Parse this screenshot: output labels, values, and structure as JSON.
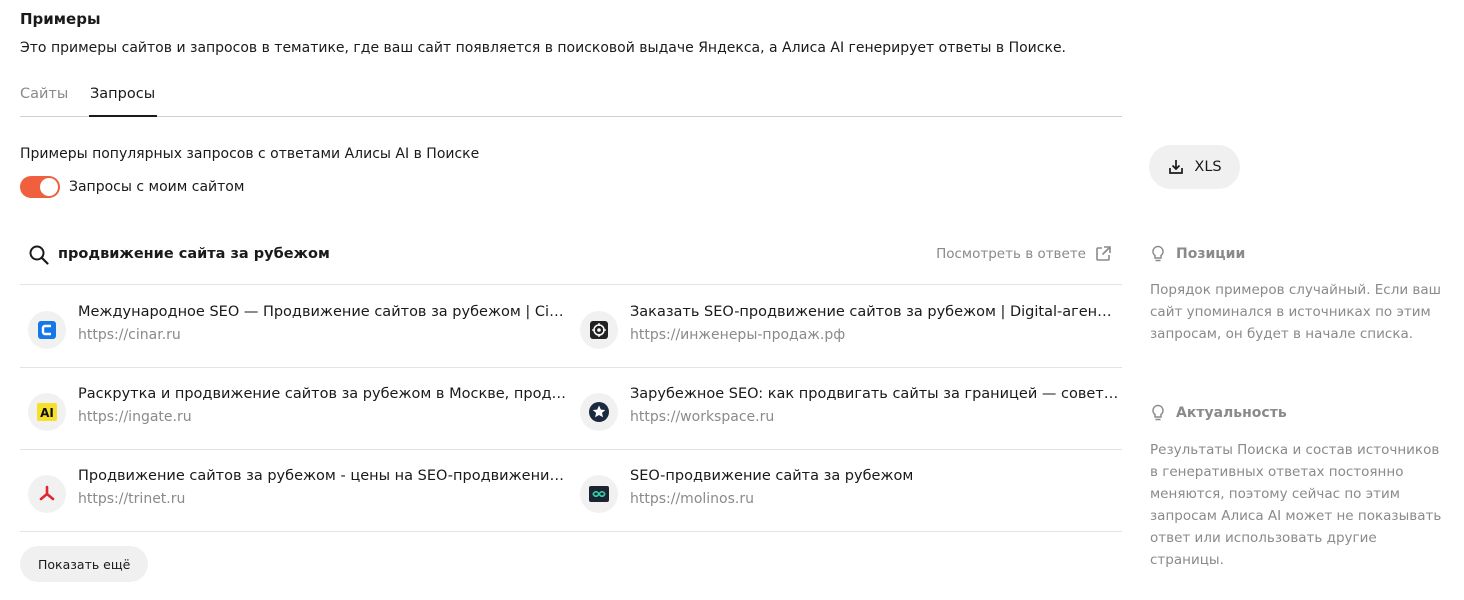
{
  "header": {
    "title": "Примеры",
    "description": "Это примеры сайтов и запросов в тематике, где ваш сайт появляется в поисковой выдаче Яндекса, а Алиса AI генерирует ответы в Поиске."
  },
  "tabs": [
    {
      "label": "Сайты",
      "active": false
    },
    {
      "label": "Запросы",
      "active": true
    }
  ],
  "section": {
    "subtitle": "Примеры популярных запросов с ответами Алисы AI в Поиске",
    "toggle_label": "Запросы с моим сайтом",
    "toggle_on": true
  },
  "query": {
    "text": "продвижение сайта за рубежом",
    "view_link": "Посмотреть в ответе"
  },
  "results": [
    {
      "title": "Международное SEO — Продвижение сайтов за рубежом | Cinar",
      "url": "https://cinar.ru",
      "icon": "cinar-logo-icon"
    },
    {
      "title": "Заказать SEO-продвижение сайтов за рубежом | Digital-агентство",
      "url": "https://инженеры-продаж.рф",
      "icon": "target-logo-icon"
    },
    {
      "title": "Раскрутка и продвижение сайтов за рубежом в Москве, продвижение",
      "url": "https://ingate.ru",
      "icon": "ingate-logo-icon"
    },
    {
      "title": "Зарубежное SEO: как продвигать сайты за границей — советы, практика",
      "url": "https://workspace.ru",
      "icon": "star-logo-icon"
    },
    {
      "title": "Продвижение сайтов за рубежом - цены на SEO-продвижение на англоязычном",
      "url": "https://trinet.ru",
      "icon": "trinet-logo-icon"
    },
    {
      "title": "SEO-продвижение сайта за рубежом",
      "url": "https://molinos.ru",
      "icon": "molinos-logo-icon"
    }
  ],
  "show_more_label": "Показать ещё",
  "export": {
    "label": "XLS"
  },
  "sidebar": {
    "positions": {
      "heading": "Позиции",
      "text": "Порядок примеров случайный. Если ваш сайт упоминался в источниках по этим запросам, он будет в начале списка."
    },
    "relevance": {
      "heading": "Актуальность",
      "text": "Результаты Поиска и состав источников в генеративных ответах постоянно меняются, поэтому сейчас по этим запросам Алиса AI может не показывать ответ или использовать другие страницы."
    }
  },
  "colors": {
    "accent": "#f0603f",
    "muted": "#8a8a8a",
    "text": "#1a1a1a"
  }
}
